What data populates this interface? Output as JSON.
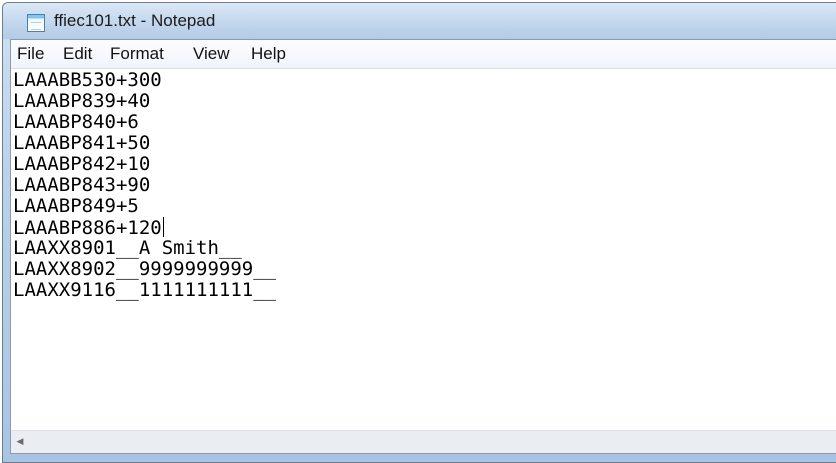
{
  "window": {
    "title": "ffiec101.txt - Notepad",
    "icon": "notepad-icon"
  },
  "menu": {
    "items": [
      {
        "label": "File"
      },
      {
        "label": "Edit"
      },
      {
        "label": "Format"
      },
      {
        "label": "View"
      },
      {
        "label": "Help"
      }
    ]
  },
  "editor": {
    "lines": [
      "LAAABB530+300",
      "LAAABP839+40",
      "LAAABP840+6",
      "LAAABP841+50",
      "LAAABP842+10",
      "LAAABP843+90",
      "LAAABP849+5",
      "LAAABP886+120",
      "LAAXX8901__A Smith__",
      "LAAXX8902__9999999999__",
      "LAAXX9116__1111111111__"
    ]
  },
  "scrollbar": {
    "left_arrow_icon": "chevron-left-icon",
    "left_arrow_glyph": "◀"
  },
  "colors": {
    "title_bar": "#c4d8ee",
    "menu_bar": "#f5f8fc",
    "text": "#000000"
  }
}
